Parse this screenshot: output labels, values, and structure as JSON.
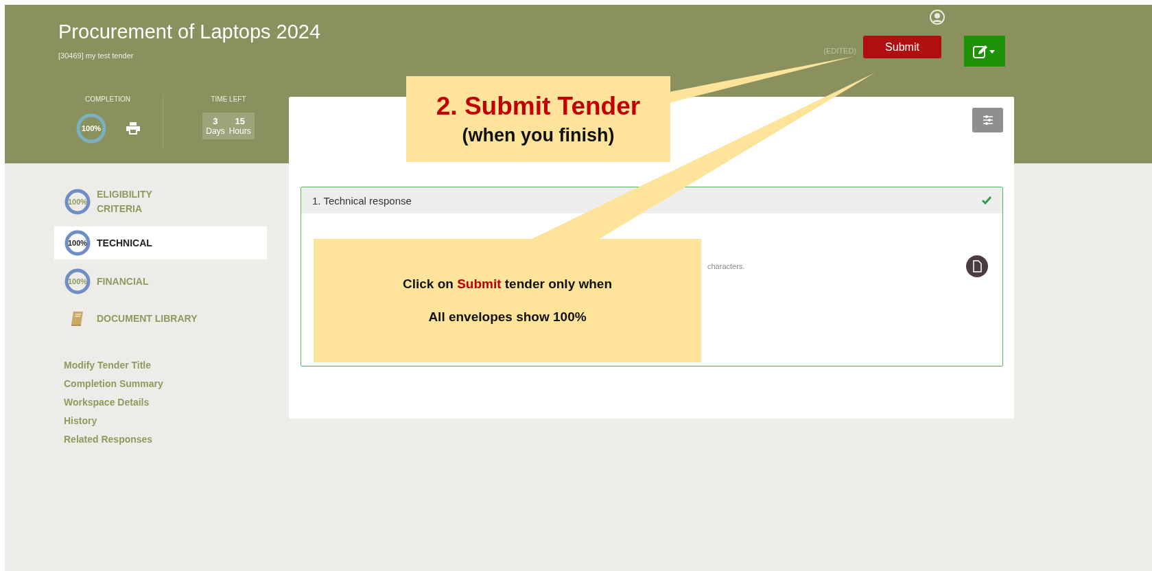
{
  "header": {
    "title": "Procurement of Laptops 2024",
    "subtitle": "[30469] my test tender",
    "completion": {
      "label": "COMPLETION",
      "percent": "100%"
    },
    "time_left": {
      "label": "TIME LEFT",
      "units": [
        {
          "value": "3",
          "unit": "Days"
        },
        {
          "value": "15",
          "unit": "Hours"
        }
      ]
    },
    "status": "(EDITED)",
    "submit_label": "Submit"
  },
  "sidebar": {
    "items": [
      {
        "kind": "envelope",
        "label": "ELIGIBILITY CRITERIA",
        "percent": "100%",
        "selected": false
      },
      {
        "kind": "envelope",
        "label": "TECHNICAL",
        "percent": "100%",
        "selected": true
      },
      {
        "kind": "envelope",
        "label": "FINANCIAL",
        "percent": "100%",
        "selected": false
      },
      {
        "kind": "library",
        "label": "DOCUMENT LIBRARY",
        "selected": false
      }
    ],
    "links": [
      "Modify Tender Title",
      "Completion Summary",
      "Workspace Details",
      "History",
      "Related Responses"
    ]
  },
  "section": {
    "title": "1. Technical response",
    "complete": true,
    "hint_fragment": "characters."
  },
  "callouts": [
    {
      "kind": "headline",
      "title": "2. Submit Tender",
      "subtitle": "(when you finish)"
    },
    {
      "kind": "note",
      "lines": [
        [
          {
            "text": "Click on ",
            "highlight": false
          },
          {
            "text": "Submit",
            "highlight": true
          },
          {
            "text": " tender only when",
            "highlight": false
          }
        ],
        [
          {
            "text": "All envelopes show 100%",
            "highlight": false
          }
        ]
      ]
    }
  ]
}
